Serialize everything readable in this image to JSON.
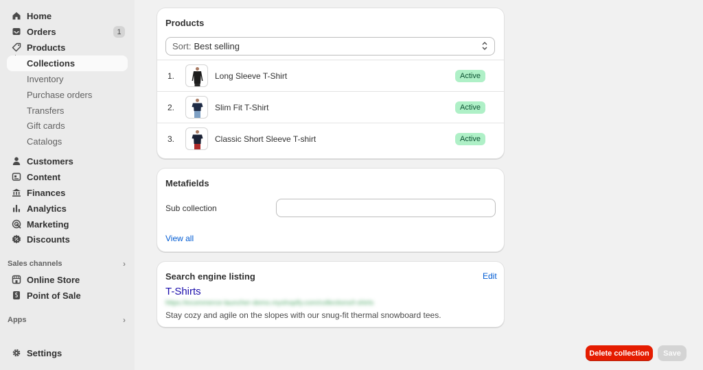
{
  "sidebar": {
    "items": [
      {
        "label": "Home",
        "icon": "home-icon"
      },
      {
        "label": "Orders",
        "icon": "inbox-icon",
        "badge": "1"
      },
      {
        "label": "Products",
        "icon": "tag-icon"
      },
      {
        "label": "Collections"
      },
      {
        "label": "Inventory"
      },
      {
        "label": "Purchase orders"
      },
      {
        "label": "Transfers"
      },
      {
        "label": "Gift cards"
      },
      {
        "label": "Catalogs"
      },
      {
        "label": "Customers",
        "icon": "person-icon"
      },
      {
        "label": "Content",
        "icon": "content-icon"
      },
      {
        "label": "Finances",
        "icon": "bank-icon"
      },
      {
        "label": "Analytics",
        "icon": "bar-chart-icon"
      },
      {
        "label": "Marketing",
        "icon": "target-icon"
      },
      {
        "label": "Discounts",
        "icon": "discount-icon"
      }
    ],
    "sales_channels_label": "Sales channels",
    "channels": [
      {
        "label": "Online Store",
        "icon": "store-icon"
      },
      {
        "label": "Point of Sale",
        "icon": "pos-icon"
      }
    ],
    "apps_label": "Apps",
    "settings_label": "Settings"
  },
  "products_card": {
    "title": "Products",
    "sort_prefix": "Sort:",
    "sort_value": "Best selling",
    "rows": [
      {
        "num": "1.",
        "name": "Long Sleeve T-Shirt",
        "status": "Active"
      },
      {
        "num": "2.",
        "name": "Slim Fit T-Shirt",
        "status": "Active"
      },
      {
        "num": "3.",
        "name": "Classic Short Sleeve T-shirt",
        "status": "Active"
      }
    ]
  },
  "metafields_card": {
    "title": "Metafields",
    "field_label": "Sub collection",
    "field_value": "",
    "view_all": "View all"
  },
  "seo_card": {
    "title": "Search engine listing",
    "edit": "Edit",
    "page_title": "T-Shirts",
    "url": "https://ecommerce-launcher-demo.myshopify.com/collections/t-shirts",
    "description": "Stay cozy and agile on the slopes with our snug-fit thermal snowboard tees."
  },
  "actions": {
    "delete_label": "Delete collection",
    "save_label": "Save"
  },
  "colors": {
    "accent_link": "#005bd3",
    "danger": "#e51c00",
    "success_badge": "#aff0c7"
  }
}
